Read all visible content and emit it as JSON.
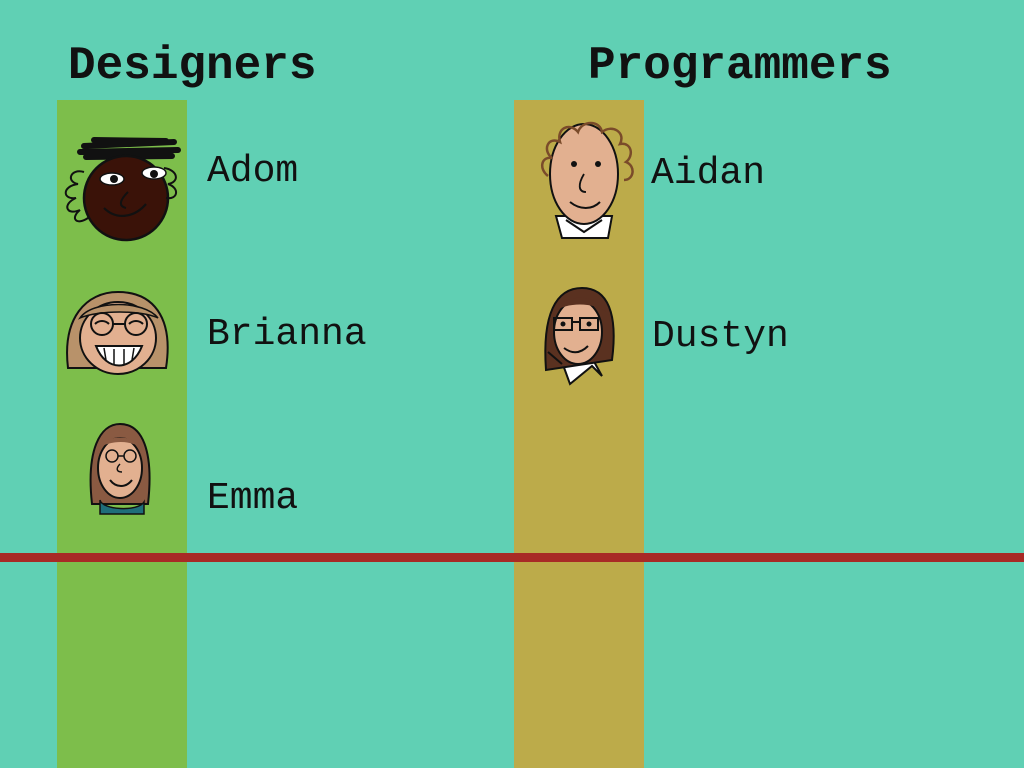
{
  "colors": {
    "background": "#60d0b4",
    "designers_column": "#7dbe4b",
    "programmers_column": "#bcab4a",
    "divider": "#a82a26",
    "text": "#111111"
  },
  "designers": {
    "heading": "Designers",
    "members": [
      {
        "name": "Adom",
        "icon": "adom-face-icon"
      },
      {
        "name": "Brianna",
        "icon": "brianna-face-icon"
      },
      {
        "name": "Emma",
        "icon": "emma-face-icon"
      }
    ]
  },
  "programmers": {
    "heading": "Programmers",
    "members": [
      {
        "name": "Aidan",
        "icon": "aidan-face-icon"
      },
      {
        "name": "Dustyn",
        "icon": "dustyn-face-icon"
      }
    ]
  }
}
